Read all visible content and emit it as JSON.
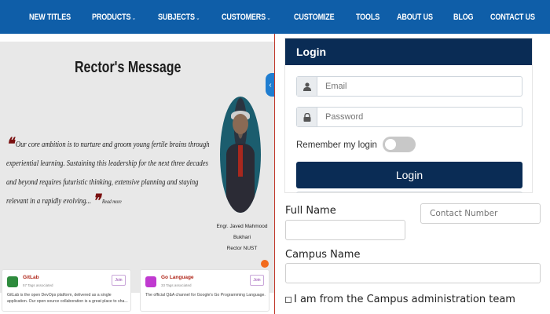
{
  "nav": {
    "items": [
      {
        "label": "NEW TITLES",
        "dropdown": false
      },
      {
        "label": "PRODUCTS",
        "dropdown": true
      },
      {
        "label": "SUBJECTS",
        "dropdown": true
      },
      {
        "label": "CUSTOMERS",
        "dropdown": true
      },
      {
        "label": "CUSTOMIZE",
        "dropdown": false
      },
      {
        "label": "TOOLS",
        "dropdown": false
      },
      {
        "label": "ABOUT US",
        "dropdown": false
      },
      {
        "label": "BLOG",
        "dropdown": false
      },
      {
        "label": "CONTACT US",
        "dropdown": false
      }
    ],
    "caret": "⌄"
  },
  "rector": {
    "title": "Rector's Message",
    "quote": "Our core ambition is to nurture and groom young fertile brains through experiential learning. Sustaining this leadership for the next three decades and beyond requires futuristic thinking, extensive planning and staying relevant in a rapidly evolving...",
    "read_more": "Read more",
    "name": "Engr. Javed Mahmood Bukhari",
    "role": "Rector NUST",
    "arrow": "‹"
  },
  "cards": [
    {
      "name": "GitLab",
      "meta": "57 Tags associated",
      "desc": "GitLab is the open DevOps platform, delivered as a single application. Our open source collaboration is a great place to sha...",
      "join": "Join",
      "color": "#2e8b3d"
    },
    {
      "name": "Go Language",
      "meta": "33 Tags associated",
      "desc": "The official Q&A channel for Google's Go Programming Language.",
      "join": "Join",
      "color": "#c03ad0"
    }
  ],
  "login": {
    "title": "Login",
    "email_placeholder": "Email",
    "password_placeholder": "Password",
    "remember_label": "Remember my login",
    "button_label": "Login"
  },
  "registration": {
    "full_name_label": "Full Name",
    "contact_placeholder": "Contact Number",
    "campus_name_label": "Campus Name",
    "campus_admin_label": "I am from the Campus administration team"
  },
  "colors": {
    "nav_bg": "#0f5ea8",
    "login_dark": "#0a2c55",
    "accent_red": "#c0392b",
    "orange": "#f26b1d"
  }
}
